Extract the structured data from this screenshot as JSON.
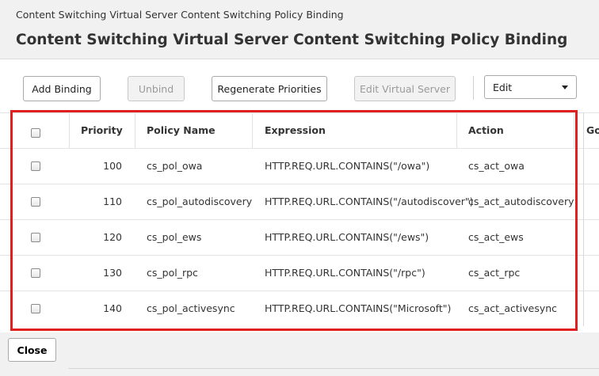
{
  "breadcrumb": "Content Switching Virtual Server Content Switching Policy Binding",
  "page_title": "Content Switching Virtual Server Content Switching Policy Binding",
  "toolbar": {
    "add_binding": "Add Binding",
    "unbind": "Unbind",
    "regenerate_priorities": "Regenerate Priorities",
    "edit_virtual_server": "Edit Virtual Server",
    "edit_select_value": "Edit"
  },
  "table": {
    "headers": {
      "priority": "Priority",
      "policy_name": "Policy Name",
      "expression": "Expression",
      "action": "Action",
      "goto": "Go"
    },
    "rows": [
      {
        "priority": "100",
        "policy_name": "cs_pol_owa",
        "expression": "HTTP.REQ.URL.CONTAINS(\"/owa\")",
        "action": "cs_act_owa"
      },
      {
        "priority": "110",
        "policy_name": "cs_pol_autodiscovery",
        "expression": "HTTP.REQ.URL.CONTAINS(\"/autodiscover\")",
        "action": "cs_act_autodiscovery"
      },
      {
        "priority": "120",
        "policy_name": "cs_pol_ews",
        "expression": "HTTP.REQ.URL.CONTAINS(\"/ews\")",
        "action": "cs_act_ews"
      },
      {
        "priority": "130",
        "policy_name": "cs_pol_rpc",
        "expression": "HTTP.REQ.URL.CONTAINS(\"/rpc\")",
        "action": "cs_act_rpc"
      },
      {
        "priority": "140",
        "policy_name": "cs_pol_activesync",
        "expression": "HTTP.REQ.URL.CONTAINS(\"Microsoft\")",
        "action": "cs_act_activesync"
      }
    ]
  },
  "footer": {
    "close": "Close"
  },
  "colors": {
    "highlight": "#e02020",
    "background": "#f1f1f1"
  },
  "icons": {
    "select_caret": "caret-down-icon",
    "checkbox": "checkbox-icon"
  }
}
